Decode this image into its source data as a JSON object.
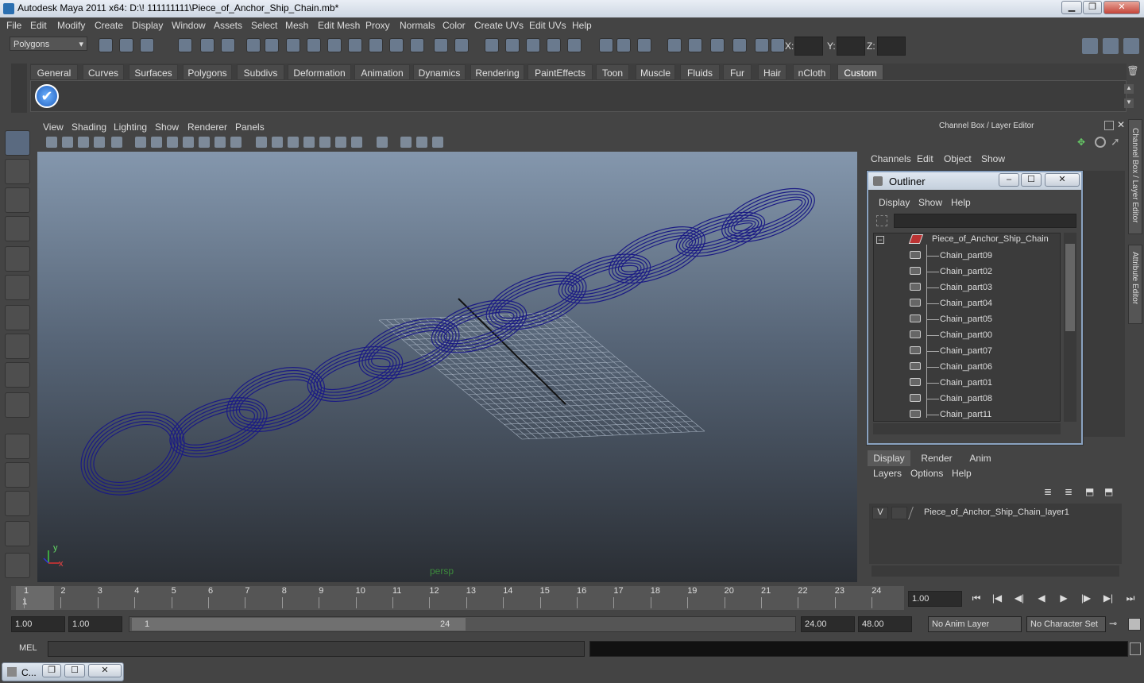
{
  "window": {
    "title": "Autodesk Maya 2011 x64: D:\\! 111111111\\Piece_of_Anchor_Ship_Chain.mb*"
  },
  "menubar": [
    "File",
    "Edit",
    "Modify",
    "Create",
    "Display",
    "Window",
    "Assets",
    "Select",
    "Mesh",
    "Edit Mesh",
    "Proxy",
    "Normals",
    "Color",
    "Create UVs",
    "Edit UVs",
    "Help"
  ],
  "toolbar": {
    "mode": "Polygons",
    "x_label": "X:",
    "y_label": "Y:",
    "z_label": "Z:"
  },
  "shelf_tabs": [
    "General",
    "Curves",
    "Surfaces",
    "Polygons",
    "Subdivs",
    "Deformation",
    "Animation",
    "Dynamics",
    "Rendering",
    "PaintEffects",
    "Toon",
    "Muscle",
    "Fluids",
    "Fur",
    "Hair",
    "nCloth",
    "Custom"
  ],
  "active_shelf": "Custom",
  "panel_menu": [
    "View",
    "Shading",
    "Lighting",
    "Show",
    "Renderer",
    "Panels"
  ],
  "viewport": {
    "camera_label": "persp",
    "axis_y": "y",
    "axis_x": "x"
  },
  "channel_box": {
    "header": "Channel Box / Layer Editor",
    "menu": [
      "Channels",
      "Edit",
      "Object",
      "Show"
    ],
    "side_tabs": [
      "Channel Box / Layer Editor",
      "Attribute Editor"
    ]
  },
  "outliner": {
    "title": "Outliner",
    "menu": [
      "Display",
      "Show",
      "Help"
    ],
    "root": "Piece_of_Anchor_Ship_Chain",
    "items": [
      "Chain_part09",
      "Chain_part02",
      "Chain_part03",
      "Chain_part04",
      "Chain_part05",
      "Chain_part00",
      "Chain_part07",
      "Chain_part06",
      "Chain_part01",
      "Chain_part08",
      "Chain_part11"
    ]
  },
  "layer_editor": {
    "tabs": [
      "Display",
      "Render",
      "Anim"
    ],
    "active_tab": "Display",
    "menu": [
      "Layers",
      "Options",
      "Help"
    ],
    "layer": {
      "visible": "V",
      "name": "Piece_of_Anchor_Ship_Chain_layer1"
    }
  },
  "timeline": {
    "ticks": [
      "1",
      "2",
      "3",
      "4",
      "5",
      "6",
      "7",
      "8",
      "9",
      "10",
      "11",
      "12",
      "13",
      "14",
      "15",
      "16",
      "17",
      "18",
      "19",
      "20",
      "21",
      "22",
      "23",
      "24"
    ],
    "current_frame": "1.00",
    "current_marker": "1"
  },
  "range": {
    "start": "1.00",
    "start2": "1.00",
    "slider_start": "1",
    "slider_end": "24",
    "end": "24.00",
    "end2": "48.00",
    "anim_layer": "No Anim Layer",
    "character_set": "No Character Set"
  },
  "command_line": {
    "label": "MEL"
  },
  "taskbar": {
    "item": "C..."
  }
}
